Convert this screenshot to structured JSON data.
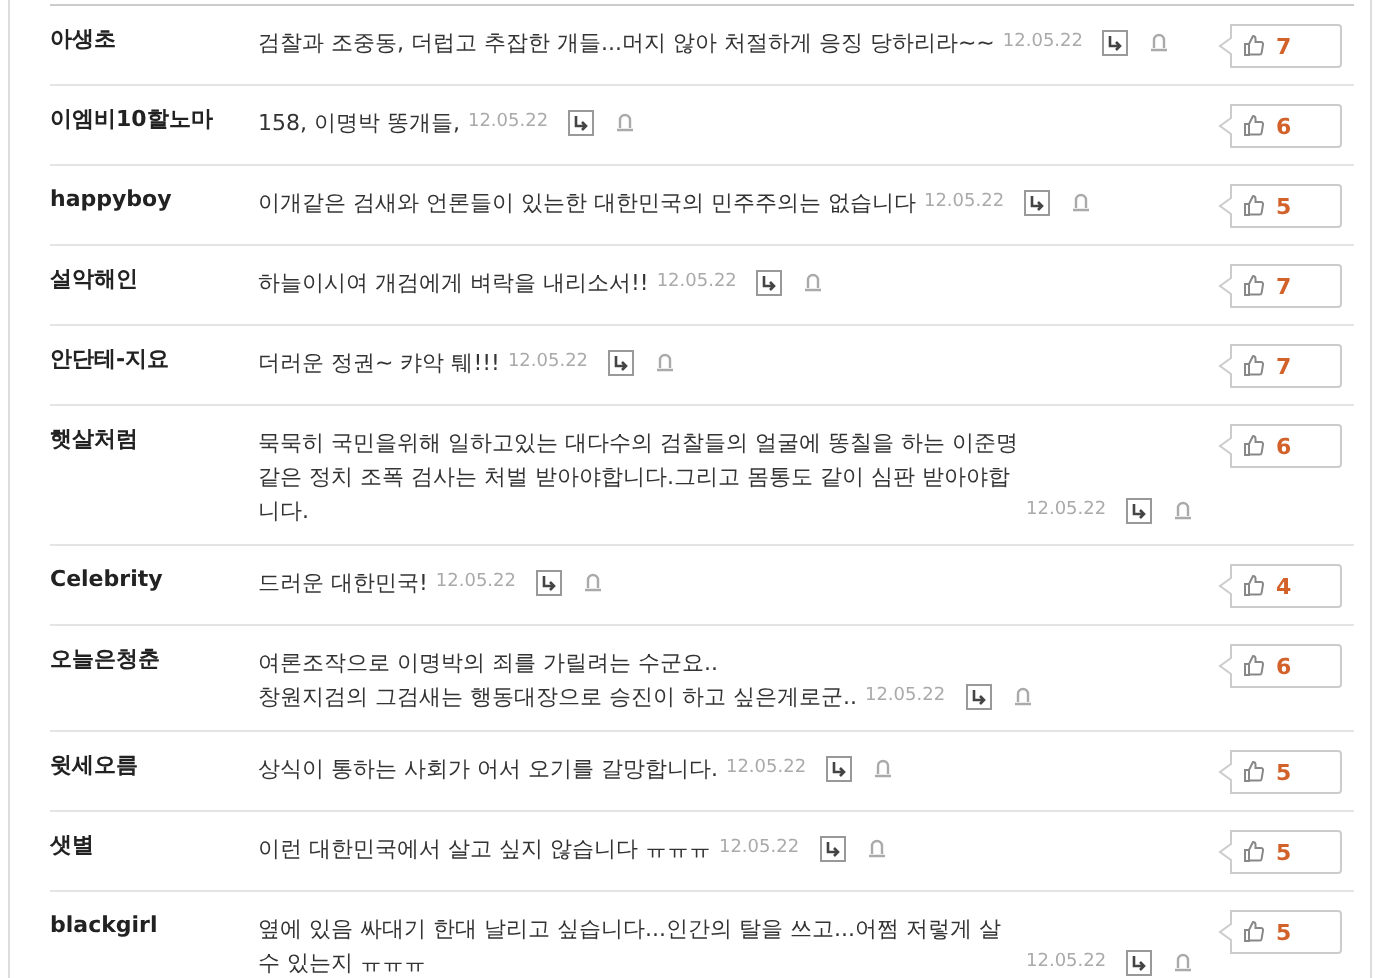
{
  "comments": [
    {
      "author": "아생초",
      "text": "검찰과 조중동, 더럽고 추잡한 개들...머지 않아 처절하게 응징 당하리라~~",
      "date": "12.05.22",
      "likes": "7"
    },
    {
      "author": "이엠비10할노마",
      "text": "158, 이명박 똥개들,",
      "date": "12.05.22",
      "likes": "6"
    },
    {
      "author": "happyboy",
      "text": "이개같은 검새와 언론들이 있는한 대한민국의 민주주의는 없습니다",
      "date": "12.05.22",
      "likes": "5"
    },
    {
      "author": "설악해인",
      "text": "하늘이시여 개검에게 벼락을 내리소서!!",
      "date": "12.05.22",
      "likes": "7"
    },
    {
      "author": "안단테-지요",
      "text": "더러운 정권~ 캬악 퉤!!!",
      "date": "12.05.22",
      "likes": "7"
    },
    {
      "author": "햇살처럼",
      "text": "묵묵히 국민을위해 일하고있는 대다수의 검찰들의 얼굴에 똥칠을 하는 이준명같은 정치 조폭 검사는 처벌 받아야합니다.그리고 몸통도 같이 심판 받아야합니다.",
      "date": "12.05.22",
      "likes": "6"
    },
    {
      "author": "Celebrity",
      "text": "드러운 대한민국!",
      "date": "12.05.22",
      "likes": "4"
    },
    {
      "author": "오늘은청춘",
      "text": "여론조작으로 이명박의 죄를 가릴려는 수군요..\n창원지검의 그검새는 행동대장으로 승진이 하고 싶은게로군..",
      "date": "12.05.22",
      "likes": "6"
    },
    {
      "author": "윗세오름",
      "text": "상식이 통하는 사회가 어서 오기를 갈망합니다.",
      "date": "12.05.22",
      "likes": "5"
    },
    {
      "author": "샛별",
      "text": "이런 대한민국에서 살고 싶지 않습니다 ㅠㅠㅠ",
      "date": "12.05.22",
      "likes": "5"
    },
    {
      "author": "blackgirl",
      "text": "옆에 있음 싸대기 한대 날리고 싶습니다...인간의 탈을 쓰고...어쩜 저렇게 살 수 있는지 ㅠㅠㅠ",
      "date": "12.05.22",
      "likes": "5"
    }
  ]
}
